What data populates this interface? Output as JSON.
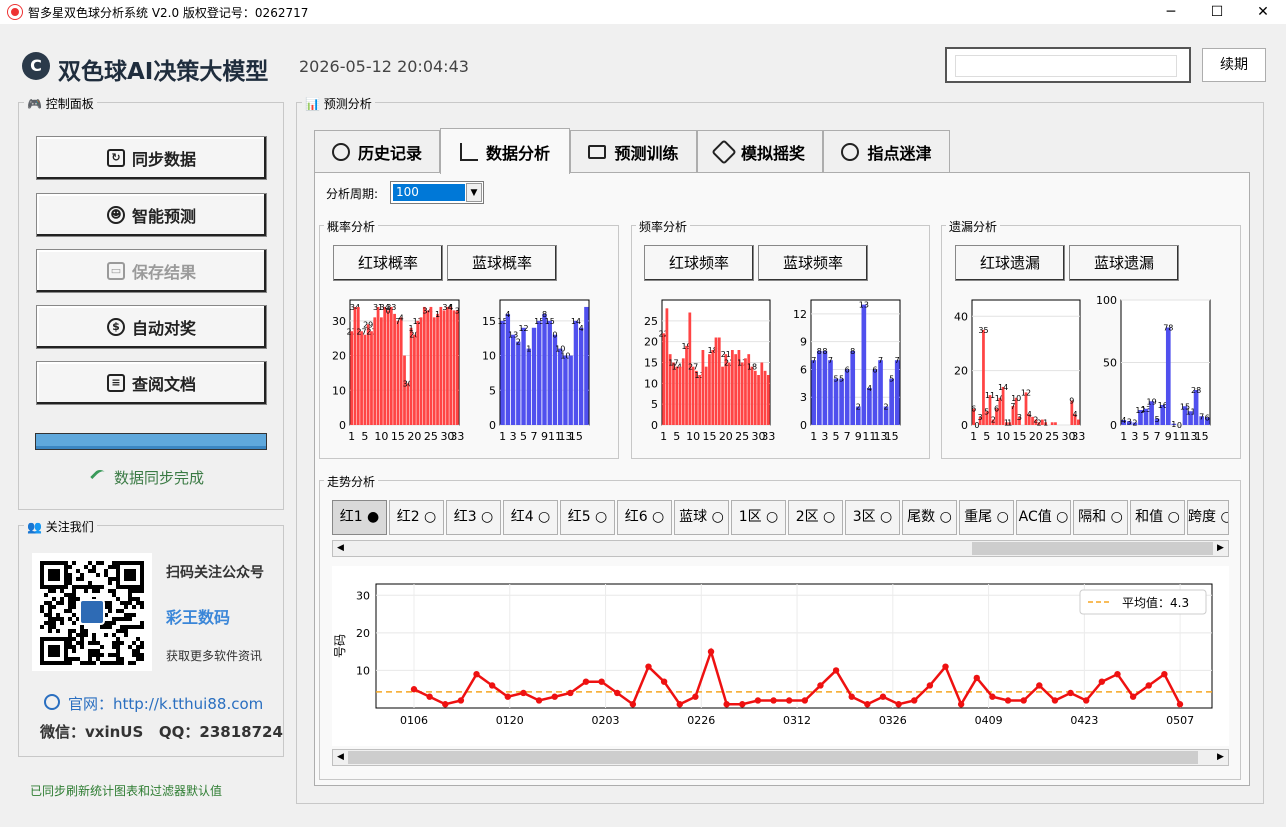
{
  "window": {
    "title": "智多星双色球分析系统 V2.0   版权登记号：0262717",
    "minimize": "─",
    "maximize": "☐",
    "close": "✕"
  },
  "header": {
    "logo": "C",
    "title": "双色球AI决策大模型",
    "datetime": "2026-05-12 20:04:43",
    "renew_label": "续期"
  },
  "control_panel": {
    "label": "控制面板",
    "buttons": [
      "同步数据",
      "智能预测",
      "保存结果",
      "自动对奖",
      "查阅文档"
    ],
    "progress": 1.0,
    "status": "数据同步完成"
  },
  "follow": {
    "label": "关注我们",
    "scan": "扫码关注公众号",
    "brand": "彩王数码",
    "more": "获取更多软件资讯",
    "website": "官网：http://k.tthui88.com",
    "wechat": "微信：vxinUS   QQ：23818724"
  },
  "footer_status": "已同步刷新统计图表和过滤器默认值",
  "prediction": {
    "label": "预测分析",
    "tabs": [
      "历史记录",
      "数据分析",
      "预测训练",
      "模拟摇奖",
      "指点迷津"
    ],
    "active_tab": 1
  },
  "period": {
    "label": "分析周期:",
    "value": "100"
  },
  "sections": {
    "prob": {
      "label": "概率分析",
      "red_btn": "红球概率",
      "blue_btn": "蓝球概率"
    },
    "freq": {
      "label": "频率分析",
      "red_btn": "红球频率",
      "blue_btn": "蓝球频率"
    },
    "miss": {
      "label": "遗漏分析",
      "red_btn": "红球遗漏",
      "blue_btn": "蓝球遗漏"
    }
  },
  "trend": {
    "label": "走势分析",
    "tabs": [
      "红1 ●",
      "红2 ○",
      "红3 ○",
      "红4 ○",
      "红5 ○",
      "红6 ○",
      "蓝球 ○",
      "1区 ○",
      "2区 ○",
      "3区 ○",
      "尾数 ○",
      "重尾 ○",
      "AC值 ○",
      "隔和 ○",
      "和值 ○",
      "跨度 ○"
    ]
  },
  "colors": {
    "red": "#ff4444",
    "blue": "#5050ee",
    "line": "#ee1111",
    "avg": "#f5a623"
  },
  "chart_data": [
    {
      "type": "bar",
      "id": "red-prob",
      "ylim": [
        0,
        36
      ],
      "yticks": [
        0,
        10,
        20,
        30
      ],
      "xticks": [
        "1",
        "5",
        "10",
        "15",
        "20",
        "25",
        "30",
        "33"
      ],
      "values": [
        27,
        34,
        34,
        27,
        26,
        29,
        27,
        31,
        34,
        31,
        34,
        33,
        34,
        32,
        30,
        31,
        20,
        12,
        28,
        26,
        30,
        31,
        34,
        33,
        34,
        31,
        32,
        34,
        33,
        34,
        34,
        33,
        33
      ],
      "labels": {
        "0": "27",
        "1": "34",
        "3": "27",
        "5": "29",
        "6": "27",
        "8": "31",
        "10": "34",
        "11": "0",
        "12": "33",
        "14": "7",
        "15": "4",
        "17": "30",
        "18": "1",
        "19": "20",
        "20": "12",
        "23": "34",
        "26": "1",
        "29": "34",
        "30": "4",
        "32": "3"
      }
    },
    {
      "type": "bar",
      "id": "blue-prob",
      "ylim": [
        0,
        18
      ],
      "yticks": [
        0,
        5,
        10,
        15
      ],
      "xticks": [
        "1",
        "3",
        "5",
        "7",
        "9",
        "11",
        "13",
        "15"
      ],
      "values": [
        15,
        16,
        13,
        12,
        14,
        11,
        14,
        15,
        16,
        15,
        13,
        11,
        10,
        10,
        15,
        14,
        17
      ],
      "labels": {
        "0": "15",
        "1": "4",
        "2": "13",
        "3": "2",
        "4": "12",
        "5": "1",
        "7": "15",
        "8": "8",
        "9": "15",
        "10": "0",
        "11": "10",
        "12": "10",
        "14": "14",
        "15": "4"
      }
    },
    {
      "type": "bar",
      "id": "red-freq",
      "ylim": [
        0,
        30
      ],
      "yticks": [
        0,
        5,
        10,
        15,
        20,
        25
      ],
      "xticks": [
        "1",
        "5",
        "10",
        "15",
        "20",
        "25",
        "30",
        "33"
      ],
      "values": [
        22,
        28,
        17,
        15,
        14,
        14,
        16,
        19,
        27,
        14,
        13,
        12,
        18,
        14,
        17,
        18,
        21,
        21,
        14,
        17,
        15,
        18,
        17,
        18,
        15,
        16,
        17,
        14,
        13,
        12,
        15,
        13,
        12
      ],
      "labels": {
        "0": "22",
        "3": "17",
        "4": "14",
        "7": "19",
        "9": "27",
        "11": "13",
        "15": "18",
        "19": "21",
        "20": "21",
        "24": "17",
        "27": "18"
      }
    },
    {
      "type": "bar",
      "id": "blue-freq",
      "ylim": [
        0,
        13.5
      ],
      "yticks": [
        0,
        3,
        6,
        9,
        12
      ],
      "xticks": [
        "1",
        "3",
        "5",
        "7",
        "9",
        "11",
        "13",
        "15"
      ],
      "values": [
        7,
        8,
        8,
        7,
        5,
        5,
        6,
        8,
        2,
        13,
        4,
        6,
        7,
        2,
        5,
        7
      ],
      "labels": {
        "0": "7",
        "1": "8",
        "2": "8",
        "3": "7",
        "4": "5",
        "5": "5",
        "6": "6",
        "7": "8",
        "8": "2",
        "9": "13",
        "10": "4",
        "11": "6",
        "12": "7",
        "13": "2",
        "14": "5",
        "15": "7"
      }
    },
    {
      "type": "bar",
      "id": "red-miss",
      "ylim": [
        0,
        46
      ],
      "yticks": [
        0,
        20,
        40
      ],
      "xticks": [
        "1",
        "5",
        "10",
        "15",
        "20",
        "25",
        "30",
        "33"
      ],
      "values": [
        6,
        0,
        3,
        35,
        5,
        11,
        2,
        6,
        10,
        14,
        1,
        1,
        7,
        10,
        3,
        0,
        12,
        4,
        3,
        2,
        1,
        2,
        1,
        0,
        1,
        1,
        0,
        0,
        0,
        0,
        9,
        4,
        2
      ],
      "labels": {
        "0": "6",
        "1": "0",
        "2": "3",
        "3": "35",
        "4": "5",
        "5": "11",
        "6": "2",
        "7": "6",
        "8": "10",
        "9": "14",
        "10": "1",
        "11": "1",
        "12": "7",
        "13": "10",
        "14": "3",
        "16": "12",
        "17": "4",
        "19": "2",
        "20": "2",
        "22": "1",
        "30": "9",
        "31": "4"
      }
    },
    {
      "type": "bar",
      "id": "blue-miss",
      "ylim": [
        0,
        100
      ],
      "yticks": [
        0,
        50,
        100
      ],
      "xticks": [
        "1",
        "3",
        "5",
        "7",
        "9",
        "11",
        "13",
        "15"
      ],
      "values": [
        4,
        3,
        2,
        12,
        13,
        19,
        5,
        16,
        78,
        1,
        0,
        15,
        11,
        28,
        7,
        6
      ],
      "labels": {
        "0": "4",
        "1": "3",
        "2": "2",
        "3": "12",
        "4": "13",
        "5": "19",
        "6": "5",
        "7": "16",
        "8": "78",
        "9": "1",
        "10": "0",
        "11": "15",
        "12": "11",
        "13": "28",
        "14": "7",
        "15": "6"
      }
    },
    {
      "type": "line",
      "id": "trend",
      "ylabel": "号码",
      "ylim": [
        0,
        33
      ],
      "yticks": [
        10,
        20,
        30
      ],
      "xticks": [
        "0106",
        "0120",
        "0203",
        "0226",
        "0312",
        "0326",
        "0409",
        "0423",
        "0507"
      ],
      "legend": "平均值：4.3",
      "average": 4.3,
      "values": [
        5,
        3,
        1,
        2,
        9,
        6,
        3,
        4,
        2,
        3,
        4,
        7,
        7,
        4,
        1,
        11,
        7,
        1,
        3,
        15,
        1,
        1,
        2,
        2,
        2,
        2,
        6,
        10,
        3,
        1,
        3,
        1,
        2,
        6,
        11,
        1,
        8,
        3,
        2,
        2,
        6,
        2,
        4,
        2,
        7,
        9,
        3,
        6,
        9,
        1
      ]
    }
  ]
}
